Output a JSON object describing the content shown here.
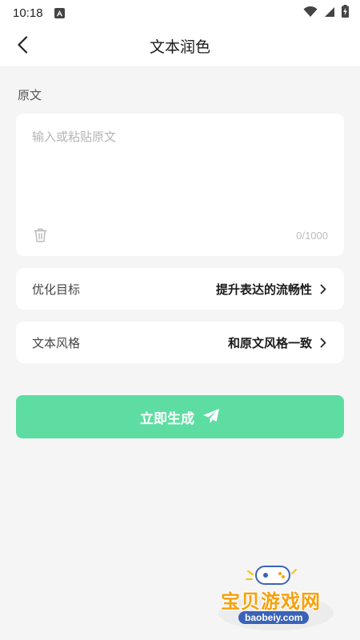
{
  "status_bar": {
    "time": "10:18",
    "notification_icon": "a-icon",
    "wifi_icon": "wifi-icon",
    "signal_icon": "signal-icon",
    "battery_icon": "battery-charging-icon"
  },
  "header": {
    "back_icon": "chevron-left-icon",
    "title": "文本润色"
  },
  "source": {
    "label": "原文",
    "placeholder": "输入或粘贴原文",
    "value": "",
    "delete_icon": "trash-icon",
    "counter": "0/1000"
  },
  "options": [
    {
      "label": "优化目标",
      "value": "提升表达的流畅性",
      "icon": "chevron-right-icon"
    },
    {
      "label": "文本风格",
      "value": "和原文风格一致",
      "icon": "chevron-right-icon"
    }
  ],
  "generate_button": {
    "label": "立即生成",
    "icon": "paper-plane-icon",
    "color": "#5ddda2"
  },
  "watermark": {
    "title": "宝贝游戏网",
    "url": "baobeiy.com"
  },
  "colors": {
    "background": "#f5f5f5",
    "card": "#ffffff",
    "accent": "#5ddda2"
  }
}
